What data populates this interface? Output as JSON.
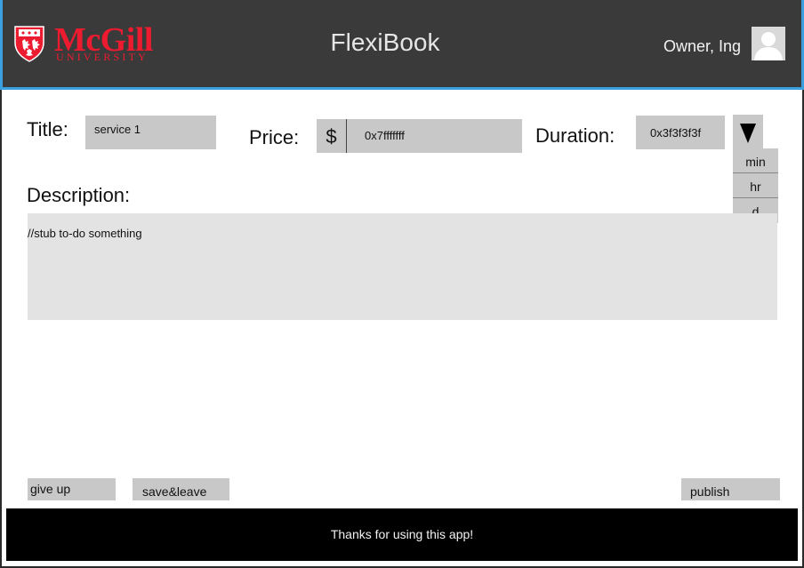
{
  "header": {
    "logo": {
      "word": "McGill",
      "sub": "UNIVERSITY"
    },
    "app_title": "FlexiBook",
    "user_name": "Owner, Ing",
    "colors": {
      "bar": "#3a3a3a",
      "accent": "#3aa0e0",
      "logo": "#ed1b2f"
    }
  },
  "form": {
    "title": {
      "label": "Title:",
      "value": "service 1"
    },
    "price": {
      "label": "Price:",
      "currency": "$",
      "value": "0x7fffffff"
    },
    "duration": {
      "label": "Duration:",
      "value": "0x3f3f3f3f",
      "toggle_icon": "triangle-down-icon",
      "options": [
        "min",
        "hr",
        "d"
      ]
    },
    "description": {
      "label": "Description:",
      "value": "//stub to-do something"
    }
  },
  "actions": {
    "give_up": "give up",
    "save_leave": "save&leave",
    "publish": "publish"
  },
  "footer": {
    "text": "Thanks for using this app!"
  }
}
